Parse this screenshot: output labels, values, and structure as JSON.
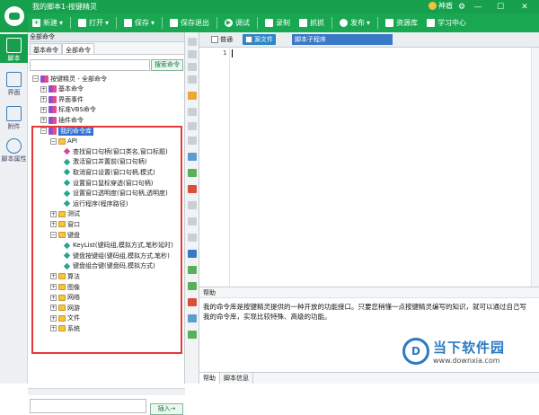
{
  "window": {
    "title": "我的脚本1-按键精灵",
    "user": "神盾"
  },
  "toolbar": {
    "items": [
      "新建",
      "打开",
      "保存",
      "保存退出",
      "调试",
      "录制",
      "抓抓",
      "发布",
      "资源库",
      "学习中心"
    ]
  },
  "leftbar": {
    "items": [
      "脚本",
      "界面",
      "附件",
      "脚本属性"
    ]
  },
  "panel": {
    "header": "全部命令",
    "tabs": [
      "基本命令",
      "全部命令"
    ],
    "search_button": "搜索命令",
    "insert_button": "插入→",
    "tree": [
      {
        "label": "按键精灵 - 全部命令",
        "level": 0,
        "type": "root"
      },
      {
        "label": "基本命令",
        "level": 1,
        "type": "cmd"
      },
      {
        "label": "界面事件",
        "level": 1,
        "type": "cmd"
      },
      {
        "label": "标准VBS命令",
        "level": 1,
        "type": "cmd"
      },
      {
        "label": "插件命令",
        "level": 1,
        "type": "cmd"
      },
      {
        "label": "我的命令库",
        "level": 1,
        "type": "cmd",
        "selected": true
      },
      {
        "label": "API",
        "level": 2,
        "type": "folder"
      },
      {
        "label": "查找窗口句柄(窗口类名,窗口标题)",
        "level": 3,
        "type": "pink"
      },
      {
        "label": "激活窗口并置前(窗口句柄)",
        "level": 3,
        "type": "item"
      },
      {
        "label": "取消窗口设置(窗口句柄,模式)",
        "level": 3,
        "type": "item"
      },
      {
        "label": "设置窗口鼠标穿透(窗口句柄)",
        "level": 3,
        "type": "item"
      },
      {
        "label": "设置窗口透明度(窗口句柄,透明度)",
        "level": 3,
        "type": "item"
      },
      {
        "label": "运行程序(程序路径)",
        "level": 3,
        "type": "item"
      },
      {
        "label": "测试",
        "level": 2,
        "type": "folder"
      },
      {
        "label": "窗口",
        "level": 2,
        "type": "folder"
      },
      {
        "label": "键盘",
        "level": 2,
        "type": "folder"
      },
      {
        "label": "KeyList(键码组,模拟方式,笔秒延时)",
        "level": 3,
        "type": "item"
      },
      {
        "label": "键盘按键组(键码组,模拟方式,笔秒)",
        "level": 3,
        "type": "item"
      },
      {
        "label": "键盘组合键(键盘码,模拟方式)",
        "level": 3,
        "type": "item"
      },
      {
        "label": "算法",
        "level": 2,
        "type": "folder"
      },
      {
        "label": "图像",
        "level": 2,
        "type": "folder"
      },
      {
        "label": "网络",
        "level": 2,
        "type": "folder"
      },
      {
        "label": "网游",
        "level": 2,
        "type": "folder"
      },
      {
        "label": "文件",
        "level": 2,
        "type": "folder"
      },
      {
        "label": "系统",
        "level": 2,
        "type": "folder"
      }
    ]
  },
  "editor": {
    "tabs": [
      "普通",
      "源文件"
    ],
    "dropdown": "脚本子程序",
    "line_number": "1"
  },
  "help": {
    "header": "帮助",
    "text": "我的命令库是按键精灵提供的一种开放的功能接口。只要您稍懂一点按键精灵编写的知识，就可以通过自己写我的命令库，实现比较特殊、高级的功能。",
    "tabs": [
      "帮助",
      "脚本信息"
    ]
  },
  "watermark": {
    "logo": "D",
    "title": "当下软件园",
    "url": "www.downxia.com"
  }
}
